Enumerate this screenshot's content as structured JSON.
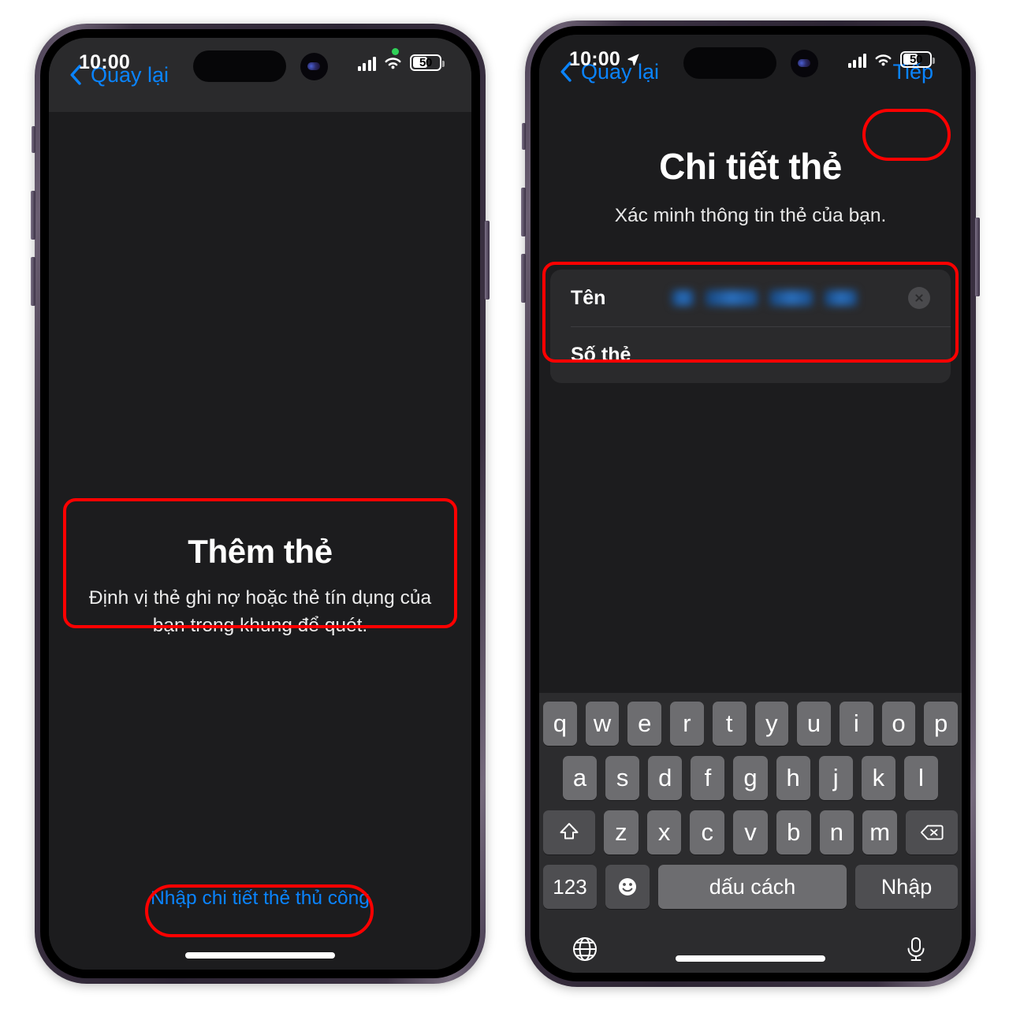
{
  "status_bar": {
    "time": "10:00",
    "battery_percent": "50",
    "icons": {
      "location": "location-arrow-icon",
      "cellular": "cellular-signal-icon",
      "wifi": "wifi-icon",
      "battery": "battery-icon",
      "recording_dot": "green-recording-indicator"
    }
  },
  "left_phone": {
    "nav": {
      "back_label": "Quay lại",
      "back_icon": "chevron-left-icon"
    },
    "scanner": {
      "title": "Thêm thẻ",
      "subtitle": "Định vị thẻ ghi nợ hoặc thẻ tín dụng của bạn trong khung để quét."
    },
    "manual_entry_label": "Nhập chi tiết thẻ thủ công"
  },
  "right_phone": {
    "nav": {
      "back_label": "Quay lại",
      "back_icon": "chevron-left-icon",
      "next_label": "Tiếp"
    },
    "page": {
      "title": "Chi tiết thẻ",
      "subtitle": "Xác minh thông tin thẻ của bạn."
    },
    "form": {
      "rows": [
        {
          "label": "Tên",
          "value": "",
          "redacted": true,
          "clear_icon": "clear-circle-x-icon"
        },
        {
          "label": "Số thẻ",
          "value": "",
          "redacted": false
        }
      ]
    },
    "keyboard": {
      "row1": [
        "q",
        "w",
        "e",
        "r",
        "t",
        "y",
        "u",
        "i",
        "o",
        "p"
      ],
      "row2": [
        "a",
        "s",
        "d",
        "f",
        "g",
        "h",
        "j",
        "k",
        "l"
      ],
      "row3": [
        "z",
        "x",
        "c",
        "v",
        "b",
        "n",
        "m"
      ],
      "shift_icon": "shift-up-arrow-icon",
      "backspace_icon": "backspace-delete-icon",
      "numbers_label": "123",
      "emoji_icon": "emoji-smiley-icon",
      "space_label": "dấu cách",
      "enter_label": "Nhập",
      "globe_icon": "globe-language-icon",
      "mic_icon": "microphone-dictation-icon"
    }
  },
  "colors": {
    "accent_blue": "#0a84ff",
    "highlight_red": "#ff0000",
    "screen_bg": "#1c1c1e",
    "card_bg": "#2a2a2c",
    "key_bg": "#6d6d70",
    "keyboard_bg": "#2c2c2e"
  }
}
